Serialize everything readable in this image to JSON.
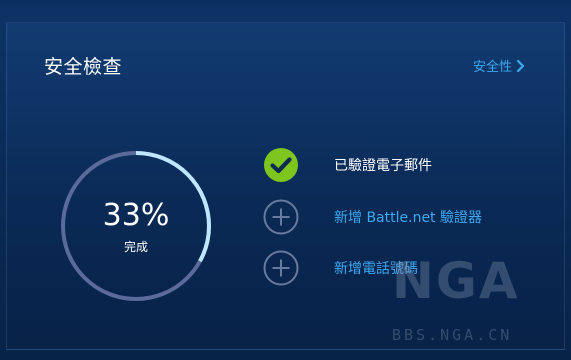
{
  "header": {
    "title": "安全檢查",
    "security_link_label": "安全性"
  },
  "progress": {
    "percent_text": "33%",
    "percent_value": 33,
    "status_label": "完成"
  },
  "checklist": [
    {
      "label": "已驗證電子郵件",
      "completed": true
    },
    {
      "label": "新增 Battle.net 驗證器",
      "completed": false
    },
    {
      "label": "新增電話號碼",
      "completed": false
    }
  ],
  "watermark": {
    "logo": "NGA",
    "url": "BBS.NGA.CN"
  },
  "colors": {
    "background": "#0a2b57",
    "accent_link": "#3ea8f0",
    "check_green": "#7ec61e",
    "ring_track": "#5a6a9a",
    "ring_progress": "#bfe6ff"
  },
  "icons": {
    "security_link": "chevron-right-icon",
    "completed": "checkmark-circle-icon",
    "pending": "plus-circle-icon"
  }
}
